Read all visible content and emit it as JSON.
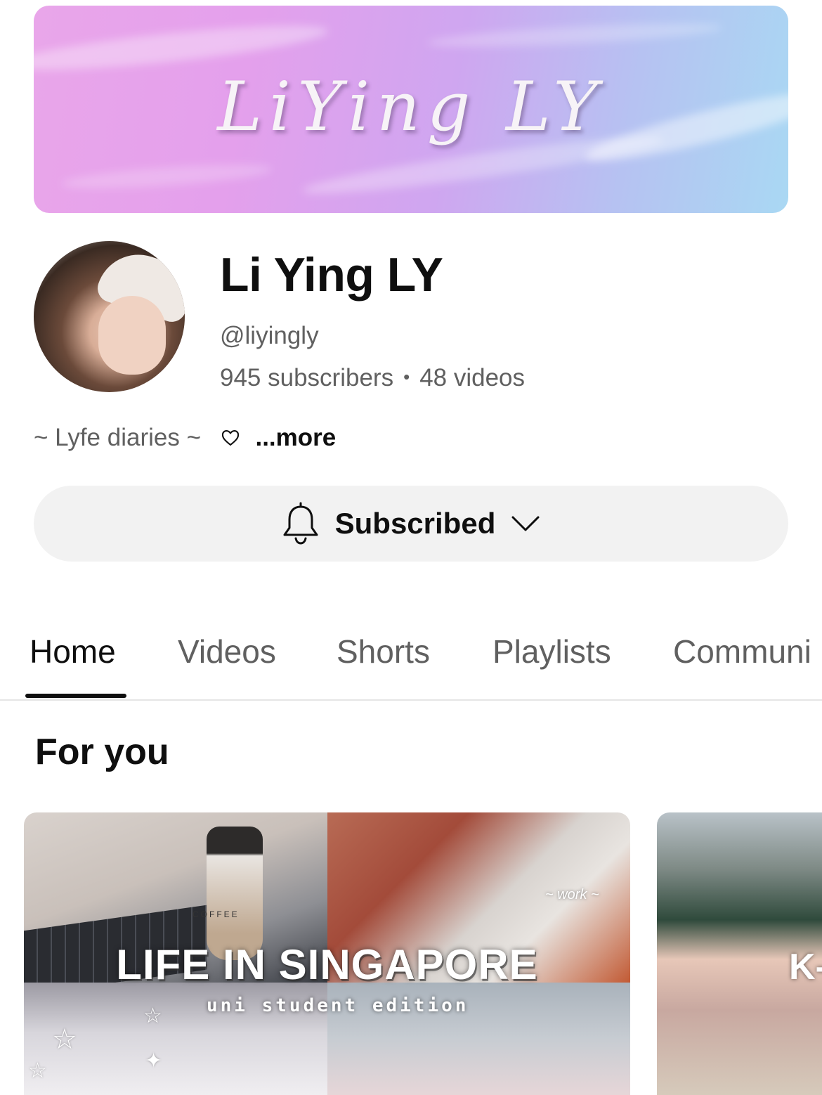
{
  "banner": {
    "title": "LiYing LY"
  },
  "channel": {
    "name": "Li Ying LY",
    "handle": "@liyingly",
    "subscribers": "945 subscribers",
    "separator": "•",
    "videos": "48 videos",
    "description": "~ Lyfe diaries ~",
    "description_icon": "heart-icon",
    "more_label": "...more"
  },
  "subscribe_button": {
    "label": "Subscribed",
    "left_icon": "bell-icon",
    "right_icon": "chevron-down-icon"
  },
  "tabs": [
    {
      "label": "Home",
      "active": true
    },
    {
      "label": "Videos",
      "active": false
    },
    {
      "label": "Shorts",
      "active": false
    },
    {
      "label": "Playlists",
      "active": false
    },
    {
      "label": "Communi",
      "active": false
    }
  ],
  "section": {
    "title": "For you"
  },
  "videos": [
    {
      "thumbnail_title": "LIFE IN SINGAPORE",
      "thumbnail_subtitle": "uni student edition",
      "thumbnail_tag": "~ work ~",
      "thumbnail_label": "COFFEE"
    },
    {
      "thumbnail_title": "K-"
    }
  ],
  "colors": {
    "text_primary": "#0f0f0f",
    "text_secondary": "#606060",
    "button_bg": "#f2f2f2",
    "divider": "#e5e5e5"
  }
}
